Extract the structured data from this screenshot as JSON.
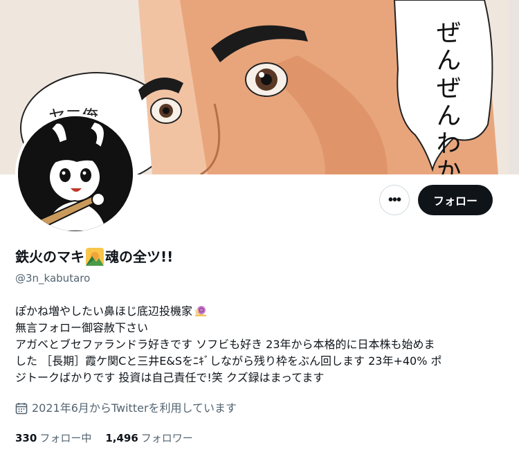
{
  "header": {
    "banner_text_right": "ぜんぜんわからない",
    "banner_text_left": "ヤ二俺"
  },
  "actions": {
    "more_label": "•••",
    "follow_label": "フォロー"
  },
  "profile": {
    "name_part1": "鉄火のマキ",
    "name_part2": "魂の全ツ!!",
    "handle": "@3n_kabutaro",
    "bio_line1": "ぽかね増やしたい鼻ほじ底辺投機家",
    "bio_line2": "無言フォロー御容赦下さい",
    "bio_line3": "アガベとブセファランドラ好きです ソフビも好き 23年から本格的に日本株も始めま",
    "bio_line4": "した ［長期］霞ケ関Cと三井E&Sをﾆｷﾞしながら残り枠をぶん回します 23年+40% ポ",
    "bio_line5": "ジトークばかりです 投資は自己責任で!笑 クズ録はまってます",
    "joined": "2021年6月からTwitterを利用しています"
  },
  "stats": {
    "following_count": "330",
    "following_label": "フォロー中",
    "followers_count": "1,496",
    "followers_label": "フォロワー"
  },
  "icons": {
    "more": "more-icon",
    "calendar": "calendar-icon",
    "emoji": "sunrise-over-mountains-emoji",
    "snail": "snail-emoji"
  }
}
